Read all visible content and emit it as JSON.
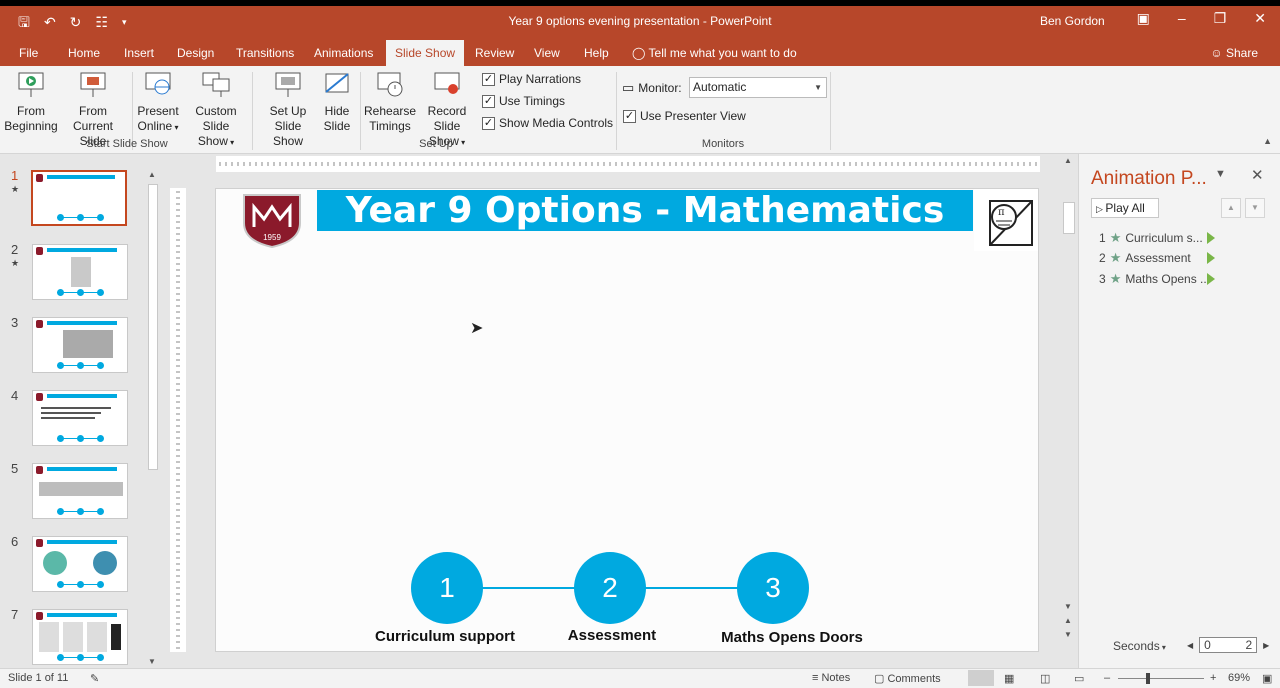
{
  "window": {
    "title": "Year 9 options evening presentation - PowerPoint",
    "user": "Ben Gordon"
  },
  "tabs": [
    "File",
    "Home",
    "Insert",
    "Design",
    "Transitions",
    "Animations",
    "Slide Show",
    "Review",
    "View",
    "Help"
  ],
  "active_tab": "Slide Show",
  "tell_me": "Tell me what you want to do",
  "share": "Share",
  "ribbon": {
    "start": {
      "from_beginning": [
        "From",
        "Beginning"
      ],
      "from_current": [
        "From",
        "Current Slide"
      ],
      "present_online": [
        "Present",
        "Online"
      ],
      "custom_show": [
        "Custom Slide",
        "Show"
      ],
      "group": "Start Slide Show"
    },
    "setup": {
      "setup_show": [
        "Set Up",
        "Slide Show"
      ],
      "hide_slide": [
        "Hide",
        "Slide"
      ],
      "rehearse": [
        "Rehearse",
        "Timings"
      ],
      "record": [
        "Record Slide",
        "Show"
      ],
      "play_narrations": "Play Narrations",
      "use_timings": "Use Timings",
      "show_media": "Show Media Controls",
      "group": "Set Up"
    },
    "monitors": {
      "monitor_label": "Monitor:",
      "monitor_value": "Automatic",
      "presenter_view": "Use Presenter View",
      "group": "Monitors"
    }
  },
  "slide": {
    "title": "Year 9 Options - Mathematics",
    "crest_year": "1959",
    "steps": [
      {
        "num": "1",
        "label": "Curriculum support"
      },
      {
        "num": "2",
        "label": "Assessment"
      },
      {
        "num": "3",
        "label": "Maths Opens Doors"
      }
    ]
  },
  "thumbnails": [
    "1",
    "2",
    "3",
    "4",
    "5",
    "6",
    "7"
  ],
  "animation_pane": {
    "title": "Animation P...",
    "play_all": "Play All",
    "items": [
      {
        "num": "1",
        "label": "Curriculum s..."
      },
      {
        "num": "2",
        "label": "Assessment"
      },
      {
        "num": "3",
        "label": "Maths Opens ..."
      }
    ],
    "seconds": "Seconds",
    "timeline_start": "0",
    "timeline_end": "2"
  },
  "status": {
    "slide_info": "Slide 1 of 11",
    "notes": "Notes",
    "comments": "Comments",
    "zoom": "69%"
  }
}
